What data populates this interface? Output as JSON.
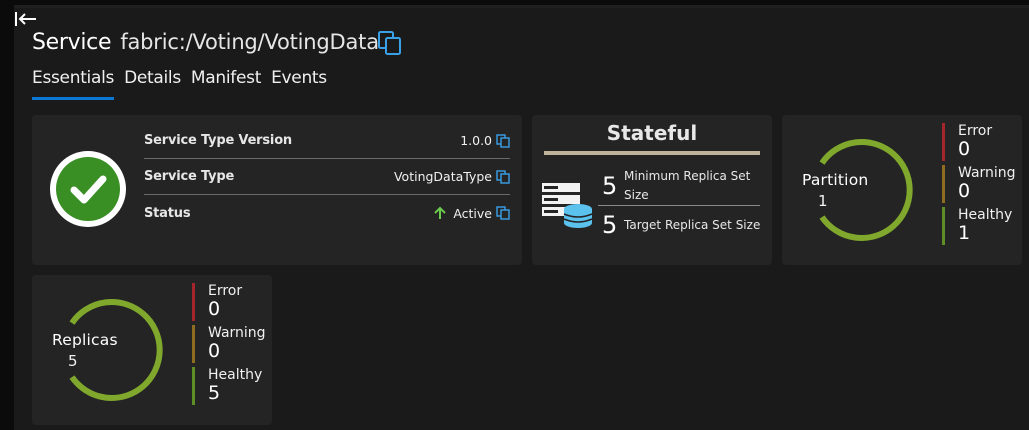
{
  "header": {
    "kind": "Service",
    "name": "fabric:/Voting/VotingData"
  },
  "tabs": [
    {
      "label": "Essentials",
      "active": true
    },
    {
      "label": "Details",
      "active": false
    },
    {
      "label": "Manifest",
      "active": false
    },
    {
      "label": "Events",
      "active": false
    }
  ],
  "essentials": {
    "health_icon": "check-icon",
    "rows": [
      {
        "label": "Service Type Version",
        "value": "1.0.0"
      },
      {
        "label": "Service Type",
        "value": "VotingDataType"
      },
      {
        "label": "Status",
        "value": "Active",
        "icon": "up-arrow-icon"
      }
    ]
  },
  "stateful": {
    "title": "Stateful",
    "min_replica_count": "5",
    "min_replica_label_1": "Minimum Replica Set",
    "min_replica_label_2": "Size",
    "target_replica_count": "5",
    "target_replica_label": "Target Replica Set Size"
  },
  "partition": {
    "label": "Partition",
    "count": "1",
    "stats": [
      {
        "label": "Error",
        "value": "0"
      },
      {
        "label": "Warning",
        "value": "0"
      },
      {
        "label": "Healthy",
        "value": "1"
      }
    ]
  },
  "replicas": {
    "label": "Replicas",
    "count": "5",
    "stats": [
      {
        "label": "Error",
        "value": "0"
      },
      {
        "label": "Warning",
        "value": "0"
      },
      {
        "label": "Healthy",
        "value": "5"
      }
    ]
  },
  "colors": {
    "accent": "#0a78d4",
    "healthy": "#5e8f26",
    "ring": "#7fa82c",
    "warning": "#8e6c20",
    "error": "#a4262c",
    "card": "#242424"
  }
}
